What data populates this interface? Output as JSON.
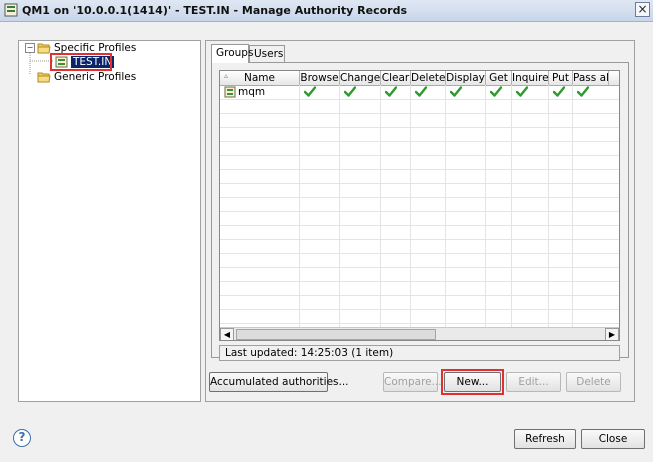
{
  "window": {
    "title": "QM1 on '10.0.0.1(1414)' - TEST.IN - Manage Authority Records",
    "close_glyph": "×"
  },
  "tree": {
    "root_label": "Specific Profiles",
    "selected_child": "TEST.IN",
    "sibling_label": "Generic Profiles"
  },
  "tabs": [
    {
      "label": "Groups",
      "active": true
    },
    {
      "label": "Users",
      "active": false
    }
  ],
  "grid": {
    "columns": [
      "Name",
      "Browse",
      "Change",
      "Clear",
      "Delete",
      "Display",
      "Get",
      "Inquire",
      "Put",
      "Pass al"
    ],
    "rows": [
      {
        "name": "mqm",
        "checks": [
          true,
          true,
          true,
          true,
          true,
          true,
          true,
          true,
          true
        ]
      }
    ]
  },
  "status_text": "Last updated: 14:25:03 (1 item)",
  "buttons": {
    "accumulated": "Accumulated authorities...",
    "compare": "Compare...",
    "new": "New...",
    "edit": "Edit...",
    "delete": "Delete",
    "refresh": "Refresh",
    "close": "Close"
  },
  "help_glyph": "?",
  "colors": {
    "check_green": "#2e9a2e",
    "highlight_red": "#e03030",
    "selection_blue": "#0a246a"
  }
}
